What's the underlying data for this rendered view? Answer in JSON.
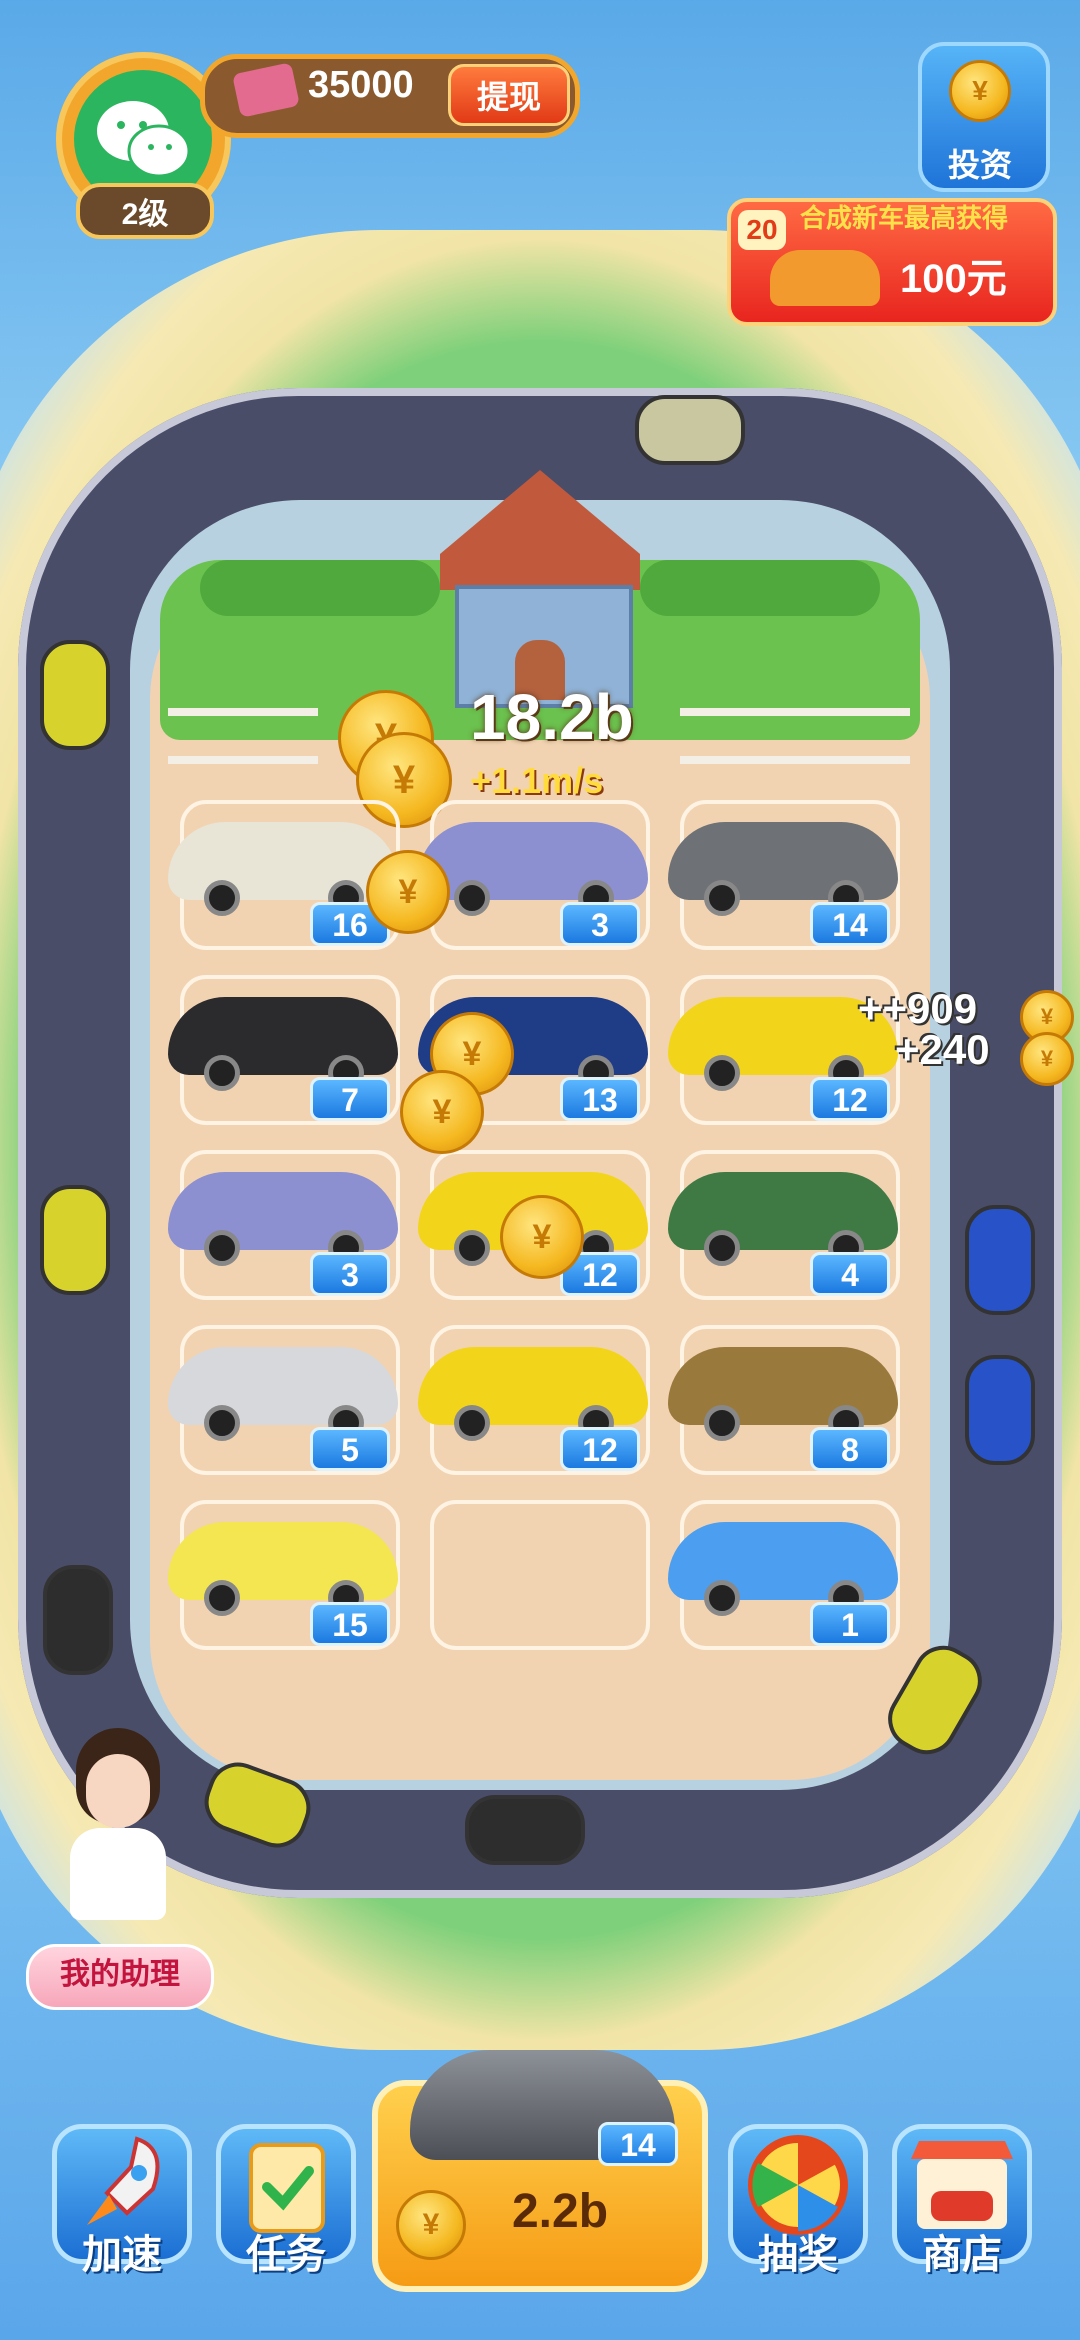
{
  "profile": {
    "level": "2级",
    "balance": "35000",
    "withdraw_label": "提现"
  },
  "invest": {
    "label": "投资"
  },
  "reward_banner": {
    "car_level": "20",
    "title": "合成新车最高获得",
    "amount": "100元"
  },
  "income": {
    "total": "18.2b",
    "rate": "+1.1m/s"
  },
  "popups": [
    "++909",
    "+240"
  ],
  "grid": [
    {
      "level": "16",
      "color": "#e8e4d6"
    },
    {
      "level": "3",
      "color": "#8c8fd0"
    },
    {
      "level": "14",
      "color": "#6e7176"
    },
    {
      "level": "7",
      "color": "#2b2b2e"
    },
    {
      "level": "13",
      "color": "#1f3d87"
    },
    {
      "level": "12",
      "color": "#f2d51a"
    },
    {
      "level": "3",
      "color": "#8c8fd0"
    },
    {
      "level": "12",
      "color": "#f2d51a"
    },
    {
      "level": "4",
      "color": "#3f7a45"
    },
    {
      "level": "5",
      "color": "#d6d8dc"
    },
    {
      "level": "12",
      "color": "#f2d51a"
    },
    {
      "level": "8",
      "color": "#9a7a3c"
    },
    {
      "level": "15",
      "color": "#f3e650"
    },
    null,
    {
      "level": "1",
      "color": "#4b9ef0"
    }
  ],
  "coin_symbol": "¥",
  "assistant": {
    "label": "我的助理"
  },
  "bottom_bar": {
    "speedup_label": "加速",
    "tasks_label": "任务",
    "buy_level": "14",
    "buy_price": "2.2b",
    "lottery_label": "抽奖",
    "shop_label": "商店"
  }
}
